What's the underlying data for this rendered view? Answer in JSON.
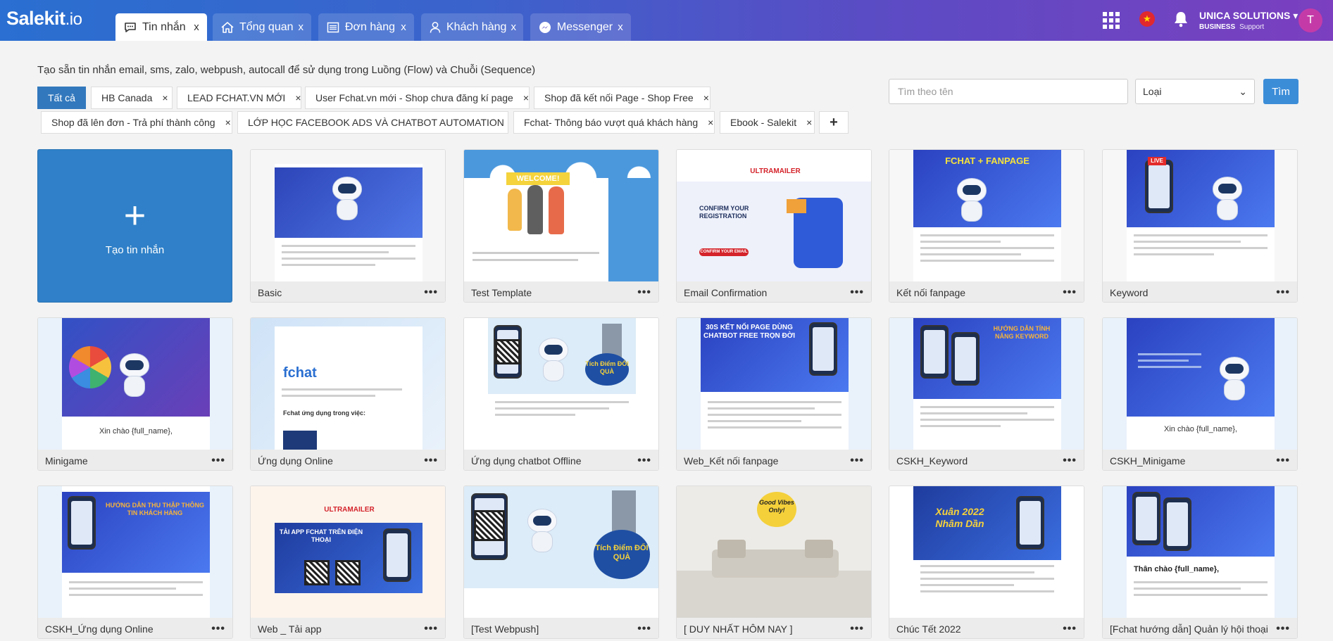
{
  "app": {
    "logo_main": "Salekit",
    "logo_suffix": ".io"
  },
  "tabs": [
    {
      "label": "Tin nhắn",
      "icon": "chat-icon",
      "close": "x",
      "active": true
    },
    {
      "label": "Tổng quan",
      "icon": "home-icon",
      "close": "x",
      "active": false
    },
    {
      "label": "Đơn hàng",
      "icon": "list-icon",
      "close": "x",
      "active": false
    },
    {
      "label": "Khách hàng",
      "icon": "user-icon",
      "close": "x",
      "active": false
    },
    {
      "label": "Messenger",
      "icon": "messenger-icon",
      "close": "x",
      "active": false
    }
  ],
  "header": {
    "flag_star": "★",
    "user_name": "UNICA SOLUTIONS",
    "user_plan": "BUSINESS",
    "user_support": "Support",
    "avatar_letter": "T",
    "caret": "▾"
  },
  "description": "Tạo sẵn tin nhắn email, sms, zalo, webpush, autocall để sử dụng trong Luồng (Flow) và Chuỗi (Sequence)",
  "filters": {
    "all_label": "Tất cả",
    "close": "×",
    "add": "+",
    "tags": [
      "HB Canada",
      "LEAD FCHAT.VN MỚI",
      "User Fchat.vn mới - Shop chưa đăng kí page",
      "Shop đã kết nối Page - Shop Free",
      "Shop đã lên đơn - Trả phí thành công",
      "LỚP HỌC FACEBOOK ADS VÀ CHATBOT AUTOMATION",
      "Fchat- Thông báo vượt quá khách hàng",
      "Ebook - Salekit"
    ]
  },
  "search": {
    "placeholder": "Tìm theo tên",
    "type_label": "Loại",
    "type_caret": "⌄",
    "button": "Tìm"
  },
  "create_card": {
    "plus": "+",
    "label": "Tạo tin nhắn"
  },
  "more": "•••",
  "templates": [
    {
      "name": "Basic",
      "banner_text": ""
    },
    {
      "name": "Test Template",
      "banner_text": "WELCOME!"
    },
    {
      "name": "Email Confirmation",
      "banner_text": "CONFIRM YOUR REGISTRATION",
      "brand": "ULTRAMAILER",
      "cta": "CONFIRM YOUR EMAIL"
    },
    {
      "name": "Kết nối fanpage",
      "banner_text": "FCHAT + FANPAGE"
    },
    {
      "name": "Keyword",
      "banner_text": "LIVE"
    },
    {
      "name": "Minigame",
      "banner_text": "Xin chào {full_name},"
    },
    {
      "name": "Ứng dụng Online",
      "banner_text": "fchat",
      "sub_text": "Fchat ứng dụng trong việc:"
    },
    {
      "name": "Ứng dụng chatbot Offline",
      "banner_text": "Tích Điểm ĐỔI QUÀ"
    },
    {
      "name": "Web_Kết nối fanpage",
      "banner_text": "30S KẾT NỐI PAGE DÙNG CHATBOT FREE TRỌN ĐỜI"
    },
    {
      "name": "CSKH_Keyword",
      "banner_text": "HƯỚNG DẪN TÍNH NĂNG KEYWORD"
    },
    {
      "name": "CSKH_Minigame",
      "banner_text": "Xin chào {full_name},"
    },
    {
      "name": "CSKH_Ứng dụng Online",
      "banner_text": "HƯỚNG DẪN THU THẬP THÔNG TIN KHÁCH HÀNG"
    },
    {
      "name": "Web _ Tải app",
      "banner_text": "TẢI APP FCHAT TRÊN ĐIỆN THOẠI",
      "brand": "ULTRAMAILER"
    },
    {
      "name": "[Test Webpush]",
      "banner_text": "Tích Điểm ĐỔI QUÀ"
    },
    {
      "name": "[ DUY NHẤT HÔM NAY ]",
      "banner_text": "Good Vibes Only!"
    },
    {
      "name": "Chúc Tết 2022",
      "banner_text": "Xuân 2022 Nhâm Dần"
    },
    {
      "name": "[Fchat hướng dẫn] Quản lý hội thoại",
      "banner_text": "Thân chào {full_name},"
    }
  ]
}
